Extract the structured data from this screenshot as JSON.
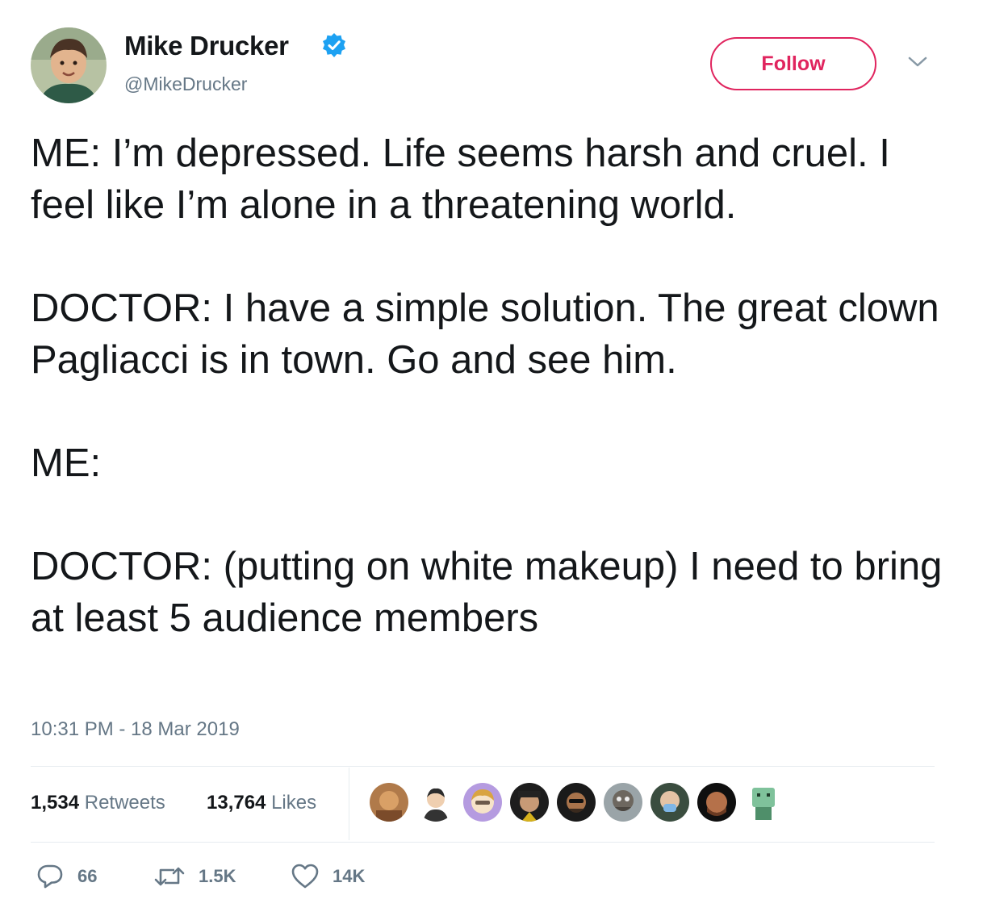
{
  "author": {
    "name": "Mike Drucker",
    "handle": "@MikeDrucker",
    "avatar_icon": "profile-photo-icon",
    "verified_icon": "verified-badge-icon"
  },
  "follow_button": {
    "label": "Follow"
  },
  "menu_icon": "chevron-down-icon",
  "tweet": {
    "text": "ME: I’m depressed. Life seems harsh and cruel. I feel like I’m alone in a threatening world.\n\nDOCTOR: I have a simple solution. The great clown Pagliacci is in town. Go and see him.\n\nME:\n\nDOCTOR: (putting on white makeup) I need to bring at least 5 audience members",
    "timestamp": "10:31 PM - 18 Mar 2019"
  },
  "stats": {
    "retweets_count": "1,534",
    "retweets_label": "Retweets",
    "likes_count": "13,764",
    "likes_label": "Likes"
  },
  "likers_facepile_count": 9,
  "actions": {
    "reply": {
      "icon": "reply-icon",
      "count": "66"
    },
    "retweet": {
      "icon": "retweet-icon",
      "count": "1.5K"
    },
    "like": {
      "icon": "heart-icon",
      "count": "14K"
    }
  },
  "colors": {
    "follow_accent": "#e0245e",
    "verified_blue": "#1da1f2",
    "secondary_text": "#657786",
    "primary_text": "#14171a",
    "divider": "#e6ecf0"
  }
}
